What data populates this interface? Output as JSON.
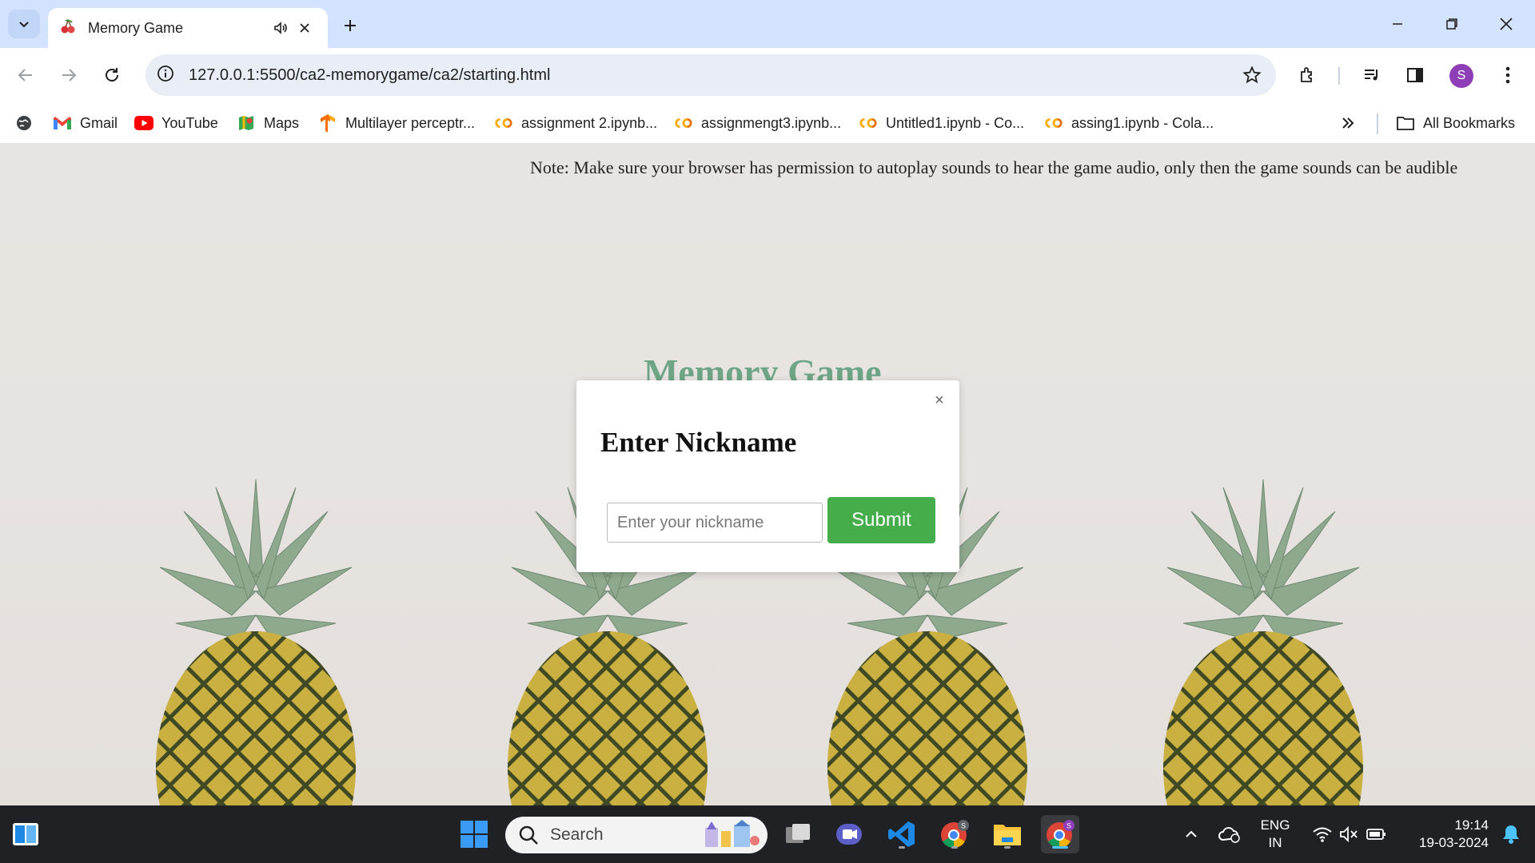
{
  "browser": {
    "tab": {
      "title": "Memory Game"
    },
    "url": "127.0.0.1:5500/ca2-memorygame/ca2/starting.html",
    "profile_initial": "S"
  },
  "bookmarks": {
    "items": [
      {
        "label": "Gmail",
        "icon": "gmail-icon"
      },
      {
        "label": "YouTube",
        "icon": "youtube-icon"
      },
      {
        "label": "Maps",
        "icon": "maps-icon"
      },
      {
        "label": "Multilayer perceptr...",
        "icon": "tensorflow-icon"
      },
      {
        "label": "assignment 2.ipynb...",
        "icon": "colab-icon"
      },
      {
        "label": "assignmengt3.ipynb...",
        "icon": "colab-icon"
      },
      {
        "label": "Untitled1.ipynb - Co...",
        "icon": "colab-icon"
      },
      {
        "label": "assing1.ipynb - Cola...",
        "icon": "colab-icon"
      }
    ],
    "all_bookmarks": "All Bookmarks"
  },
  "page": {
    "note": "Note: Make sure your browser has permission to autoplay sounds to hear the game audio, only then the game sounds can be audible",
    "title": "Memory Game",
    "modal": {
      "close": "×",
      "heading": "Enter Nickname",
      "input_placeholder": "Enter your nickname",
      "submit": "Submit"
    }
  },
  "taskbar": {
    "search_label": "Search",
    "lang_line1": "ENG",
    "lang_line2": "IN",
    "time": "19:14",
    "date": "19-03-2024"
  },
  "colors": {
    "accent_green": "#45ae4b",
    "title_green": "#6fa587",
    "tabbar": "#d3e3fd"
  }
}
